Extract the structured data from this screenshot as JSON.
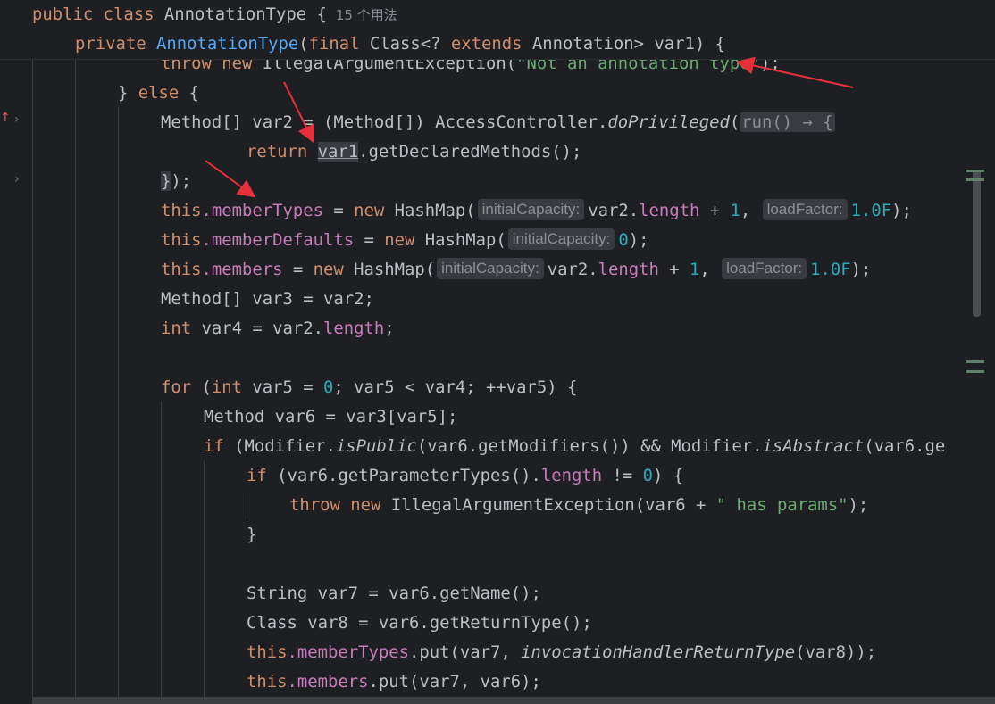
{
  "sticky": {
    "line1": {
      "kw1": "public",
      "kw2": "class",
      "name": "AnnotationType",
      "brace": " {",
      "usages": "15 个用法"
    },
    "line2": {
      "kw": "private",
      "name": "AnnotationType",
      "p1": "(",
      "kw2": "final",
      "p2": " Class<?",
      "kw3": "extends",
      "p3": " Annotation> var1) {"
    }
  },
  "code": {
    "l3": {
      "kw": "throw",
      "kw2": "new",
      "rest": " IllegalArgumentException(",
      "str": "\"Not an annotation type\"",
      "end": ");"
    },
    "l4": {
      "text": "} ",
      "kw": "else",
      "end": " {"
    },
    "l5": {
      "a": "Method[] var2 = (Method[]) AccessController.",
      "m": "doPrivileged",
      "b": "(",
      "lambda": "run() → {"
    },
    "l6": {
      "kw": "return",
      "u": "var1",
      "rest": ".getDeclaredMethods();"
    },
    "l7": {
      "brace": "}",
      "rest": ");"
    },
    "l8": {
      "this": "this",
      "f": ".memberTypes",
      "eq": " = ",
      "kw": "new",
      "c": " HashMap(",
      "h1": "initialCapacity:",
      "a": "var2.",
      "len": "length",
      "b": " + ",
      "n1": "1",
      "sep": ", ",
      "h2": "loadFactor:",
      "n2": "1.0F",
      "end": ");"
    },
    "l9": {
      "this": "this",
      "f": ".memberDefaults",
      "eq": " = ",
      "kw": "new",
      "c": " HashMap(",
      "h1": "initialCapacity:",
      "n1": "0",
      "end": ");"
    },
    "l10": {
      "this": "this",
      "f": ".members",
      "eq": " = ",
      "kw": "new",
      "c": " HashMap(",
      "h1": "initialCapacity:",
      "a": "var2.",
      "len": "length",
      "b": " + ",
      "n1": "1",
      "sep": ", ",
      "h2": "loadFactor:",
      "n2": "1.0F",
      "end": ");"
    },
    "l11": {
      "text": "Method[] var3 = var2;"
    },
    "l12": {
      "kw": "int",
      "a": " var4 = var2.",
      "len": "length",
      "end": ";"
    },
    "l14": {
      "kw": "for",
      "a": " (",
      "kw2": "int",
      "b": " var5 = ",
      "n": "0",
      "c": "; var5 < var4; ++var5) {"
    },
    "l15": {
      "text": "Method var6 = var3[var5];"
    },
    "l16": {
      "kw": "if",
      "a": " (Modifier.",
      "m1": "isPublic",
      "b": "(var6.getModifiers()) && Modifier.",
      "m2": "isAbstract",
      "c": "(var6.ge"
    },
    "l17": {
      "kw": "if",
      "a": " (var6.getParameterTypes().",
      "len": "length",
      "b": " != ",
      "n": "0",
      "c": ") {"
    },
    "l18": {
      "kw": "throw",
      "kw2": "new",
      "a": " IllegalArgumentException(var6 + ",
      "str": "\" has params\"",
      "end": ");"
    },
    "l19": {
      "text": "}"
    },
    "l21": {
      "text": "String var7 = var6.getName();"
    },
    "l22": {
      "text": "Class var8 = var6.getReturnType();"
    },
    "l23": {
      "this": "this",
      "f": ".memberTypes",
      "a": ".put(var7, ",
      "m": "invocationHandlerReturnType",
      "b": "(var8));"
    },
    "l24": {
      "this": "this",
      "f": ".members",
      "a": ".put(var7, var6);"
    }
  },
  "colors": {
    "background": "#1e1f22",
    "keyword": "#cf8e6d",
    "field": "#c77dbb",
    "number": "#2aacb8",
    "string": "#6aab73",
    "method": "#56a8f5",
    "annotation_arrow": "#e8303a"
  }
}
